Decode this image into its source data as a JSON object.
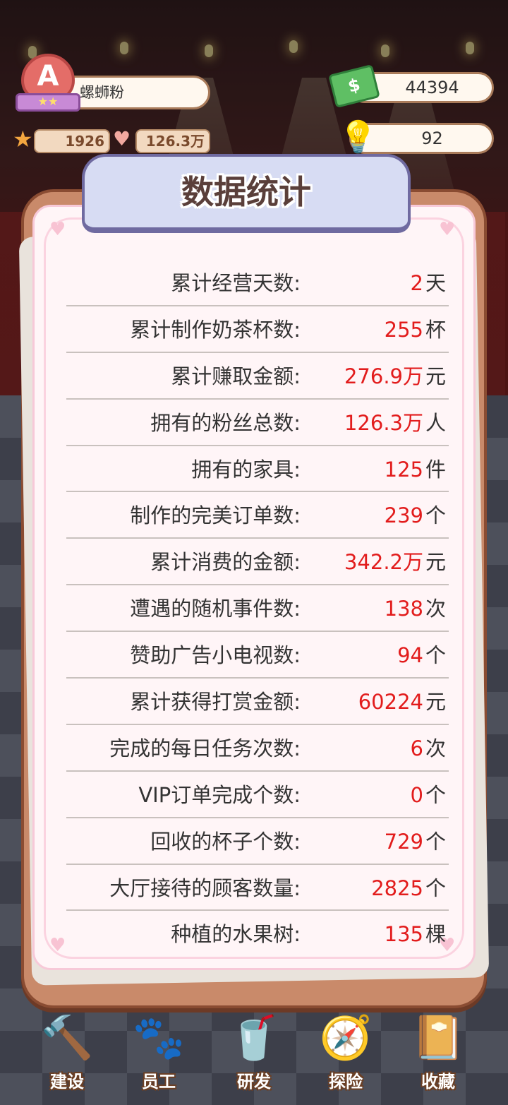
{
  "hud": {
    "rank_letter": "A",
    "rank_stars": "★★",
    "player_name": "螺蛳粉",
    "stars": "1926",
    "fans": "126.3万",
    "money": "44394",
    "ideas": "92"
  },
  "dialog": {
    "title": "数据统计",
    "stats": [
      {
        "label": "累计经营天数:",
        "value": "2",
        "unit": "天"
      },
      {
        "label": "累计制作奶茶杯数:",
        "value": "255",
        "unit": "杯"
      },
      {
        "label": "累计赚取金额:",
        "value": "276.9万",
        "unit": "元"
      },
      {
        "label": "拥有的粉丝总数:",
        "value": "126.3万",
        "unit": "人"
      },
      {
        "label": "拥有的家具:",
        "value": "125",
        "unit": "件"
      },
      {
        "label": "制作的完美订单数:",
        "value": "239",
        "unit": "个"
      },
      {
        "label": "累计消费的金额:",
        "value": "342.2万",
        "unit": "元"
      },
      {
        "label": "遭遇的随机事件数:",
        "value": "138",
        "unit": "次"
      },
      {
        "label": "赞助广告小电视数:",
        "value": "94",
        "unit": "个"
      },
      {
        "label": "累计获得打赏金额:",
        "value": "60224",
        "unit": "元"
      },
      {
        "label": "完成的每日任务次数:",
        "value": "6",
        "unit": "次"
      },
      {
        "label": "VIP订单完成个数:",
        "value": "0",
        "unit": "个"
      },
      {
        "label": "回收的杯子个数:",
        "value": "729",
        "unit": "个"
      },
      {
        "label": "大厅接待的顾客数量:",
        "value": "2825",
        "unit": "个"
      },
      {
        "label": "种植的水果树:",
        "value": "135",
        "unit": "棵"
      }
    ]
  },
  "nav": {
    "items": [
      {
        "label": "建设",
        "icon": "hammer-icon"
      },
      {
        "label": "员工",
        "icon": "paw-icon"
      },
      {
        "label": "研发",
        "icon": "milk-tea-icon"
      },
      {
        "label": "探险",
        "icon": "compass-icon"
      },
      {
        "label": "收藏",
        "icon": "album-icon"
      }
    ]
  },
  "colors": {
    "value_red": "#e21c1c",
    "dialog_frame": "#c98a6a",
    "title_tab": "#d7dcf3"
  }
}
